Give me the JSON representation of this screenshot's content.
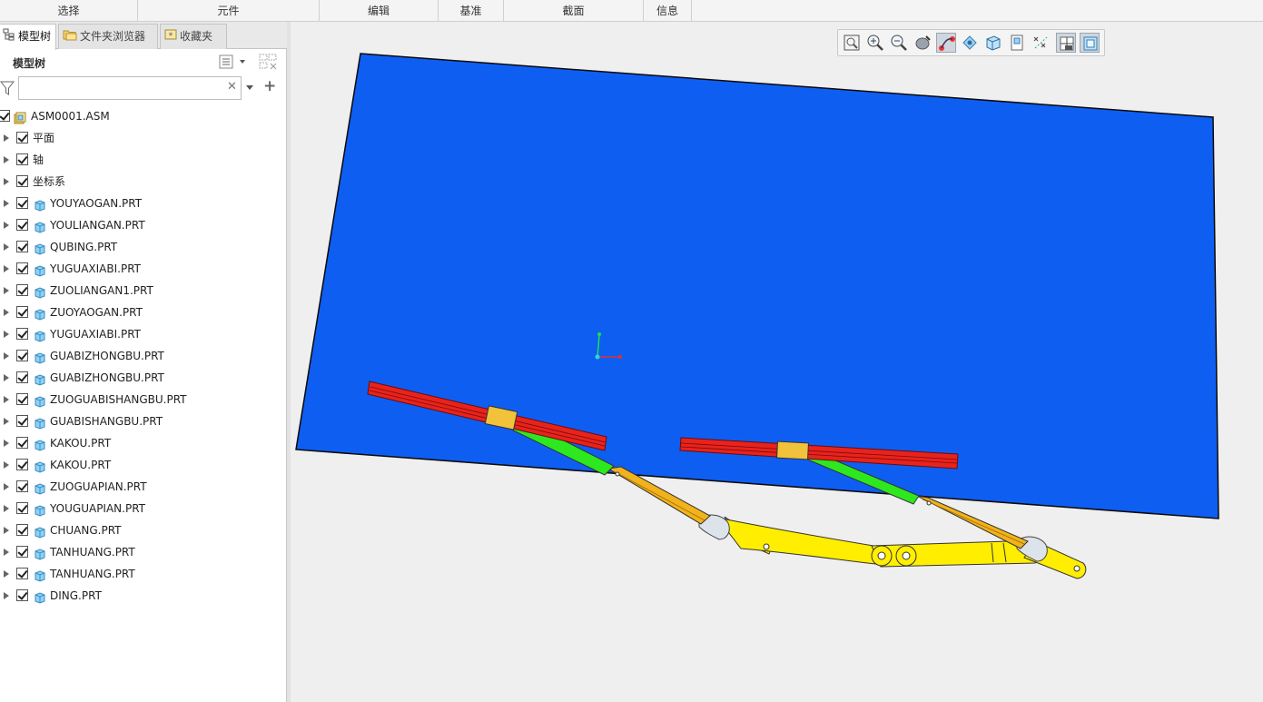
{
  "ribbon": {
    "groups": [
      {
        "label": "选择"
      },
      {
        "label": "元件"
      },
      {
        "label": "编辑"
      },
      {
        "label": "基准"
      },
      {
        "label": "截面"
      },
      {
        "label": "信息"
      }
    ]
  },
  "tabs": [
    {
      "label": "模型树",
      "icon": "model-tree-icon",
      "active": true
    },
    {
      "label": "文件夹浏览器",
      "icon": "folder-browser-icon",
      "active": false
    },
    {
      "label": "收藏夹",
      "icon": "favorites-icon",
      "active": false
    }
  ],
  "tree_panel": {
    "title": "模型树",
    "filter": {
      "value": "",
      "placeholder": ""
    }
  },
  "tree": [
    {
      "label": "ASM0001.ASM",
      "type": "asm",
      "level": 0,
      "expandable": false
    },
    {
      "label": "平面",
      "type": "group",
      "level": 1,
      "expandable": true
    },
    {
      "label": "轴",
      "type": "group",
      "level": 1,
      "expandable": true
    },
    {
      "label": "坐标系",
      "type": "group",
      "level": 1,
      "expandable": true
    },
    {
      "label": "YOUYAOGAN.PRT",
      "type": "part",
      "level": 1,
      "expandable": true
    },
    {
      "label": "YOULIANGAN.PRT",
      "type": "part",
      "level": 1,
      "expandable": true
    },
    {
      "label": "QUBING.PRT",
      "type": "part",
      "level": 1,
      "expandable": true
    },
    {
      "label": "YUGUAXIABI.PRT",
      "type": "part",
      "level": 1,
      "expandable": true
    },
    {
      "label": "ZUOLIANGAN1.PRT",
      "type": "part",
      "level": 1,
      "expandable": true
    },
    {
      "label": "ZUOYAOGAN.PRT",
      "type": "part",
      "level": 1,
      "expandable": true
    },
    {
      "label": "YUGUAXIABI.PRT",
      "type": "part",
      "level": 1,
      "expandable": true
    },
    {
      "label": "GUABIZHONGBU.PRT",
      "type": "part",
      "level": 1,
      "expandable": true
    },
    {
      "label": "GUABIZHONGBU.PRT",
      "type": "part",
      "level": 1,
      "expandable": true
    },
    {
      "label": "ZUOGUABISHANGBU.PRT",
      "type": "part",
      "level": 1,
      "expandable": true
    },
    {
      "label": "GUABISHANGBU.PRT",
      "type": "part",
      "level": 1,
      "expandable": true
    },
    {
      "label": "KAKOU.PRT",
      "type": "part",
      "level": 1,
      "expandable": true
    },
    {
      "label": "KAKOU.PRT",
      "type": "part",
      "level": 1,
      "expandable": true
    },
    {
      "label": "ZUOGUAPIAN.PRT",
      "type": "part",
      "level": 1,
      "expandable": true
    },
    {
      "label": "YOUGUAPIAN.PRT",
      "type": "part",
      "level": 1,
      "expandable": true
    },
    {
      "label": "CHUANG.PRT",
      "type": "part",
      "level": 1,
      "expandable": true
    },
    {
      "label": "TANHUANG.PRT",
      "type": "part",
      "level": 1,
      "expandable": true
    },
    {
      "label": "TANHUANG.PRT",
      "type": "part",
      "level": 1,
      "expandable": true
    },
    {
      "label": "DING.PRT",
      "type": "part",
      "level": 1,
      "expandable": true
    }
  ],
  "view_toolbar": [
    {
      "icon": "refit-icon",
      "active": false
    },
    {
      "icon": "zoom-in-icon",
      "active": false
    },
    {
      "icon": "zoom-out-icon",
      "active": false
    },
    {
      "icon": "repaint-icon",
      "active": false
    },
    {
      "icon": "display-style-icon",
      "active": true
    },
    {
      "icon": "named-views-icon",
      "active": false
    },
    {
      "icon": "saved-orientations-icon",
      "active": false
    },
    {
      "icon": "view-manager-icon",
      "active": false
    },
    {
      "icon": "datum-display-icon",
      "active": false
    },
    {
      "icon": "spin-center-icon",
      "active": true
    },
    {
      "icon": "annotation-display-icon",
      "active": true
    }
  ],
  "colors": {
    "window_glass": "#0f5ef2",
    "wiper_blade": "#e8231c",
    "wiper_arm": "#2ee81f",
    "arm_holder": "#f2b21b",
    "linkage": "#ffee00",
    "background": "#efefef"
  }
}
